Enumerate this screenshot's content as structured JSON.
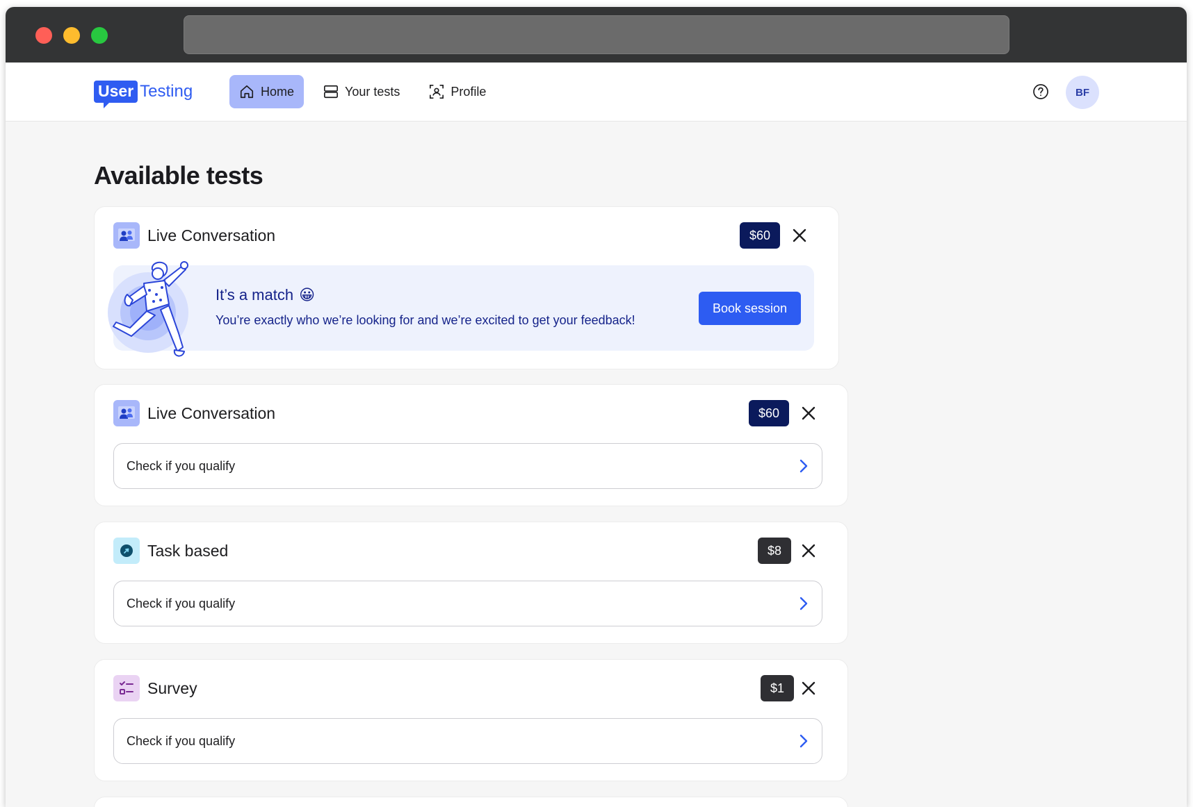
{
  "browser": {
    "url": ""
  },
  "brand": {
    "user": "User",
    "testing": "Testing"
  },
  "nav": {
    "home": "Home",
    "your_tests": "Your tests",
    "profile": "Profile"
  },
  "user": {
    "initials": "BF"
  },
  "page": {
    "title": "Available tests"
  },
  "cards": [
    {
      "type": "Live Conversation",
      "icon": "live-conversation-icon",
      "price": "$60",
      "match": {
        "title": "It’s a match",
        "emoji": "😀",
        "text": "You’re exactly who we’re looking for and we’re excited to get your feedback!",
        "button": "Book session"
      }
    },
    {
      "type": "Live Conversation",
      "icon": "live-conversation-icon",
      "price": "$60",
      "action": "Check if you qualify"
    },
    {
      "type": "Task based",
      "icon": "task-based-icon",
      "price": "$8",
      "action": "Check if you qualify"
    },
    {
      "type": "Survey",
      "icon": "survey-icon",
      "price": "$1",
      "action": "Check if you qualify"
    }
  ],
  "colors": {
    "accent": "#2d5cf2",
    "nav_active": "#a8b7fa",
    "price_navy": "#0b1a5c",
    "price_dark": "#2f2f33",
    "match_bg": "#eef2fd"
  }
}
